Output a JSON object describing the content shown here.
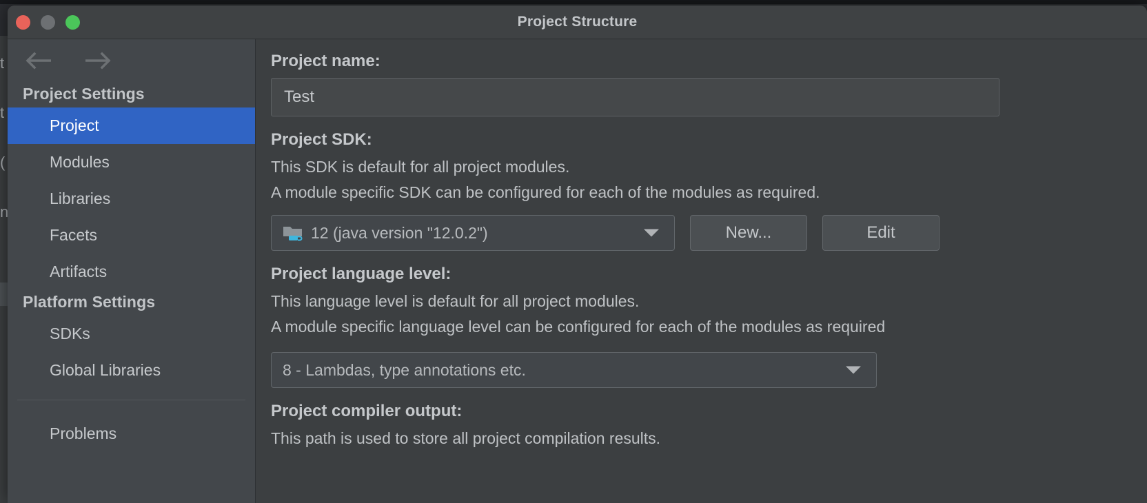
{
  "window": {
    "title": "Project Structure",
    "controls": [
      {
        "name": "close",
        "color": "#e8635a"
      },
      {
        "name": "minimize",
        "color": "#6d7073"
      },
      {
        "name": "zoom",
        "color": "#4bc65a"
      }
    ]
  },
  "sidebar": {
    "nav": {
      "back_icon": "arrow-left-icon",
      "forward_icon": "arrow-right-icon"
    },
    "groups": [
      {
        "label": "Project Settings",
        "items": [
          {
            "label": "Project",
            "selected": true
          },
          {
            "label": "Modules",
            "selected": false
          },
          {
            "label": "Libraries",
            "selected": false
          },
          {
            "label": "Facets",
            "selected": false
          },
          {
            "label": "Artifacts",
            "selected": false
          }
        ]
      },
      {
        "label": "Platform Settings",
        "items": [
          {
            "label": "SDKs",
            "selected": false
          },
          {
            "label": "Global Libraries",
            "selected": false
          }
        ]
      }
    ],
    "extra_items": [
      {
        "label": "Problems",
        "selected": false
      }
    ]
  },
  "main": {
    "project_name": {
      "label": "Project name:",
      "value": "Test",
      "placeholder": "Project name"
    },
    "project_sdk": {
      "label": "Project SDK:",
      "description_line_1": "This SDK is default for all project modules.",
      "description_line_2": "A module specific SDK can be configured for each of the modules as required.",
      "selected": "12 (java version \"12.0.2\")",
      "selected_version": "12",
      "selected_detail": "(java version \"12.0.2\")",
      "icon": "jdk-folder-icon",
      "new_button": "New...",
      "edit_button": "Edit"
    },
    "project_language_level": {
      "label": "Project language level:",
      "description_line_1": "This language level is default for all project modules.",
      "description_line_2": "A module specific language level can be configured for each of the modules as required",
      "selected": "8 - Lambdas, type annotations etc."
    },
    "project_compiler_output": {
      "label": "Project compiler output:",
      "description_line_1": "This path is used to store all project compilation results."
    }
  },
  "colors": {
    "accent_selection": "#3064c4",
    "window_bg": "#3c3f41",
    "sidebar_bg": "#43474b",
    "titlebar_bg": "#3f4244",
    "text_primary": "#c6c9cc",
    "text_muted": "#b7babd",
    "jdk_cup": "#3fb6dd"
  }
}
